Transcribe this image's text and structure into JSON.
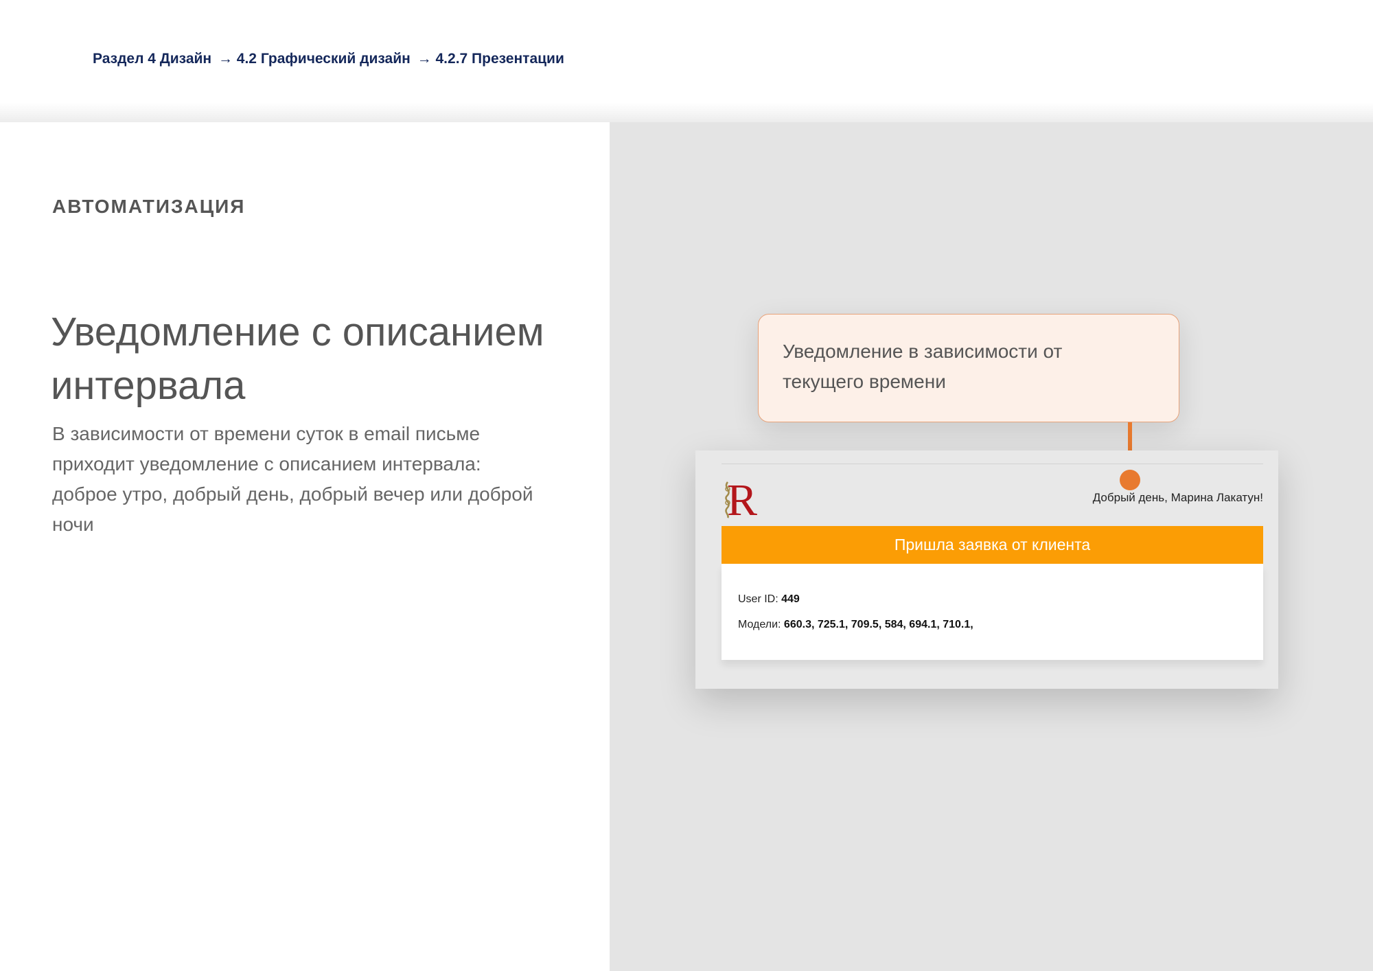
{
  "breadcrumb": {
    "part1": "Раздел 4 Дизайн ",
    "part2": "→ 4.2 Графический дизайн",
    "part3": "→ 4.2.7 Презентации"
  },
  "left": {
    "eyebrow": "АВТОМАТИЗАЦИЯ",
    "title": "Уведомление с описанием интервала",
    "description": "В зависимости от времени суток в email письме приходит уведомление с описанием интервала: доброе утро, добрый день, добрый вечер или доброй ночи"
  },
  "callout": {
    "text": "Уведомление в зависимости от текущего времени"
  },
  "email": {
    "logo_icon": "r-logo-icon",
    "greeting": "Добрый день, Марина Лакатун!",
    "banner": "Пришла заявка от клиента",
    "user_id_label": "User ID: ",
    "user_id_value": "449",
    "models_label": "Модели: ",
    "models_value": "660.3, 725.1, 709.5, 584, 694.1, 710.1,"
  },
  "colors": {
    "accent": "#e87a2f",
    "banner": "#fb9d05",
    "breadcrumb": "#14275a",
    "panel": "#e4e4e4"
  }
}
